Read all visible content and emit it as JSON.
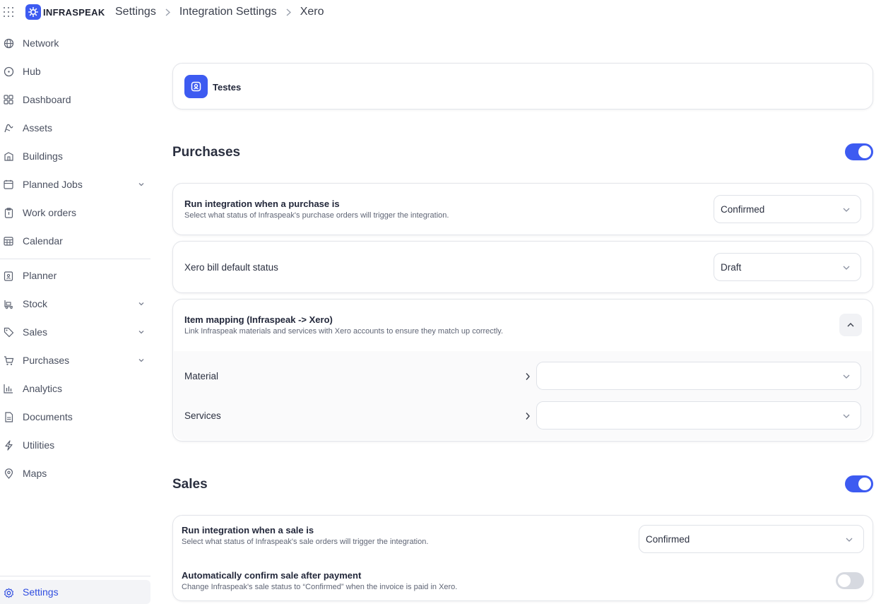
{
  "header": {
    "brand": "INFRASPEAK",
    "breadcrumbs": [
      "Settings",
      "Integration Settings",
      "Xero"
    ]
  },
  "sidebar": {
    "items": [
      {
        "label": "Network",
        "icon": "globe-icon"
      },
      {
        "label": "Hub",
        "icon": "hub-icon"
      },
      {
        "label": "Dashboard",
        "icon": "dashboard-icon"
      },
      {
        "label": "Assets",
        "icon": "assets-icon"
      },
      {
        "label": "Buildings",
        "icon": "building-icon"
      },
      {
        "label": "Planned Jobs",
        "icon": "calendar-icon",
        "expandable": true
      },
      {
        "label": "Work orders",
        "icon": "clipboard-icon"
      },
      {
        "label": "Calendar",
        "icon": "calendar-icon"
      },
      {
        "label": "Planner",
        "icon": "planner-icon"
      },
      {
        "label": "Stock",
        "icon": "stock-icon",
        "expandable": true
      },
      {
        "label": "Sales",
        "icon": "tag-icon",
        "expandable": true
      },
      {
        "label": "Purchases",
        "icon": "cart-icon",
        "expandable": true
      },
      {
        "label": "Analytics",
        "icon": "bar-chart-icon"
      },
      {
        "label": "Documents",
        "icon": "document-icon"
      },
      {
        "label": "Utilities",
        "icon": "bolt-icon"
      },
      {
        "label": "Maps",
        "icon": "pin-icon"
      }
    ],
    "settings_label": "Settings"
  },
  "company": {
    "name": "Testes"
  },
  "purchases": {
    "title": "Purchases",
    "enabled": true,
    "run_integration": {
      "title": "Run integration when a purchase is",
      "description": "Select what status of Infraspeak's purchase orders will trigger the integration.",
      "value": "Confirmed"
    },
    "bill_status": {
      "label": "Xero bill default status",
      "value": "Draft"
    },
    "item_mapping": {
      "title": "Item mapping (Infraspeak -> Xero)",
      "description": "Link Infraspeak materials and services with Xero accounts to ensure they match up correctly.",
      "rows": [
        {
          "label": "Material",
          "value": ""
        },
        {
          "label": "Services",
          "value": ""
        }
      ]
    }
  },
  "sales": {
    "title": "Sales",
    "enabled": true,
    "run_integration": {
      "title": "Run integration when a sale is",
      "description": "Select what status of Infraspeak's sale orders will trigger the integration.",
      "value": "Confirmed"
    },
    "auto_confirm": {
      "title": "Automatically confirm sale after payment",
      "description": "Change Infraspeak's sale status to “Confirmed” when the invoice is paid in Xero.",
      "enabled": false
    }
  },
  "colors": {
    "accent": "#3d5bf1",
    "toggle_off": "#d6d9e0"
  }
}
